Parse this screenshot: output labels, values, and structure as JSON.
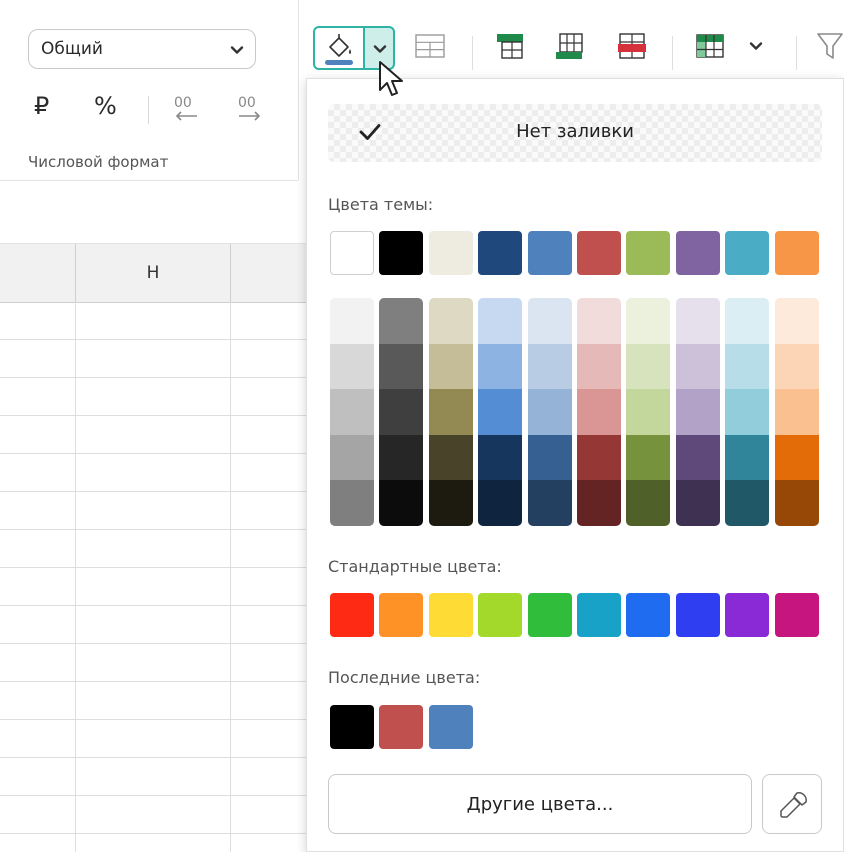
{
  "number_format": {
    "select_value": "Общий",
    "currency_symbol": "₽",
    "percent_symbol": "%",
    "group_label": "Числовой формат"
  },
  "sheet": {
    "column_header": "H"
  },
  "fill_menu": {
    "no_fill_label": "Нет заливки",
    "theme_colors_label": "Цвета темы:",
    "standard_colors_label": "Стандартные цвета:",
    "recent_colors_label": "Последние цвета:",
    "more_colors_label": "Другие цвета...",
    "theme_colors": [
      "#ffffff",
      "#000000",
      "#eeece1",
      "#1f497d",
      "#4f81bd",
      "#c0504d",
      "#9bbb59",
      "#8064a2",
      "#4bacc6",
      "#f79646"
    ],
    "theme_shades": [
      [
        "#f2f2f2",
        "#d8d8d8",
        "#bfbfbf",
        "#a5a5a5",
        "#7f7f7f"
      ],
      [
        "#7f7f7f",
        "#595959",
        "#3f3f3f",
        "#262626",
        "#0c0c0c"
      ],
      [
        "#ddd9c3",
        "#c4bd97",
        "#938953",
        "#494429",
        "#1d1b10"
      ],
      [
        "#c6d9f0",
        "#8db3e2",
        "#548dd4",
        "#17365d",
        "#0f243e"
      ],
      [
        "#dbe5f1",
        "#b8cce4",
        "#95b3d7",
        "#366092",
        "#244061"
      ],
      [
        "#f2dcdb",
        "#e5b9b7",
        "#d99694",
        "#953734",
        "#632423"
      ],
      [
        "#ebf1dd",
        "#d7e3bc",
        "#c3d69b",
        "#76923c",
        "#4f6128"
      ],
      [
        "#e5e0ec",
        "#ccc1d9",
        "#b2a2c7",
        "#5f497a",
        "#3f3151"
      ],
      [
        "#dbeef3",
        "#b7dde8",
        "#92cddc",
        "#31859b",
        "#205867"
      ],
      [
        "#fdeada",
        "#fbd5b5",
        "#fac08f",
        "#e36c09",
        "#974806"
      ]
    ],
    "standard_colors": [
      "#ff2a14",
      "#ff9227",
      "#ffdb36",
      "#a2d92a",
      "#30bd3c",
      "#18a2c8",
      "#1f6cf0",
      "#2f3ef0",
      "#8a2ad6",
      "#c7157f"
    ],
    "recent_colors": [
      "#000000",
      "#c0504d",
      "#4f81bd"
    ]
  }
}
